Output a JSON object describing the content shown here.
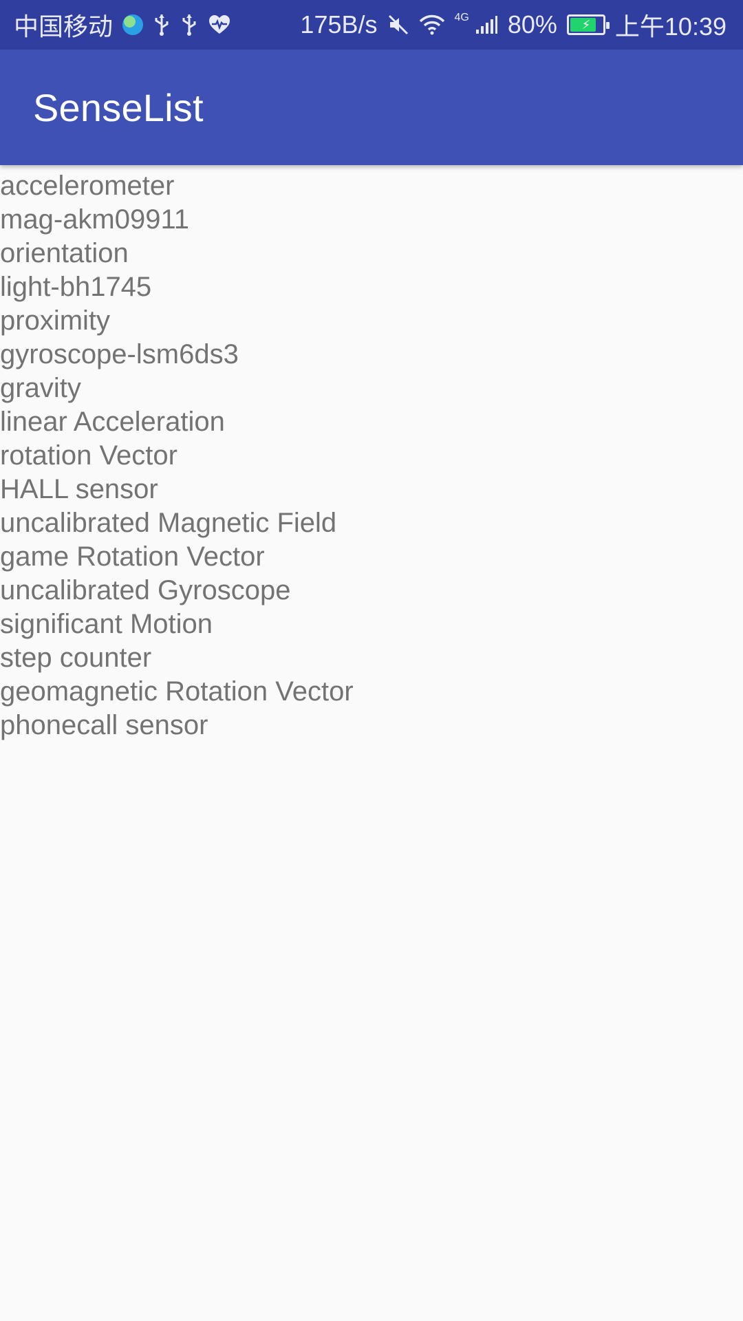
{
  "status_bar": {
    "carrier": "中国移动",
    "net_speed": "175B/s",
    "battery_level": 0.8,
    "battery_percent": "80%",
    "time": "上午10:39",
    "network_type": "4G",
    "icons": [
      "globe-icon",
      "usb-icon",
      "usb-icon",
      "heart-icon",
      "mute-icon",
      "wifi-icon",
      "signal-icon",
      "battery-icon"
    ]
  },
  "app_bar": {
    "title": "SenseList",
    "background_color": "#3f51b5"
  },
  "sensor_list": {
    "items": [
      "accelerometer",
      "mag-akm09911",
      "orientation",
      "light-bh1745",
      "proximity",
      "gyroscope-lsm6ds3",
      "gravity",
      "linear Acceleration",
      "rotation Vector",
      "HALL sensor",
      "uncalibrated Magnetic Field",
      "game Rotation Vector",
      "uncalibrated Gyroscope",
      "significant Motion",
      "step counter",
      "geomagnetic Rotation Vector",
      "phonecall sensor"
    ]
  },
  "colors": {
    "status_bar": "#303f9f",
    "app_bar": "#3f51b5",
    "background": "#fafafa",
    "text": "#737373",
    "battery_fill": "#22d36d"
  }
}
